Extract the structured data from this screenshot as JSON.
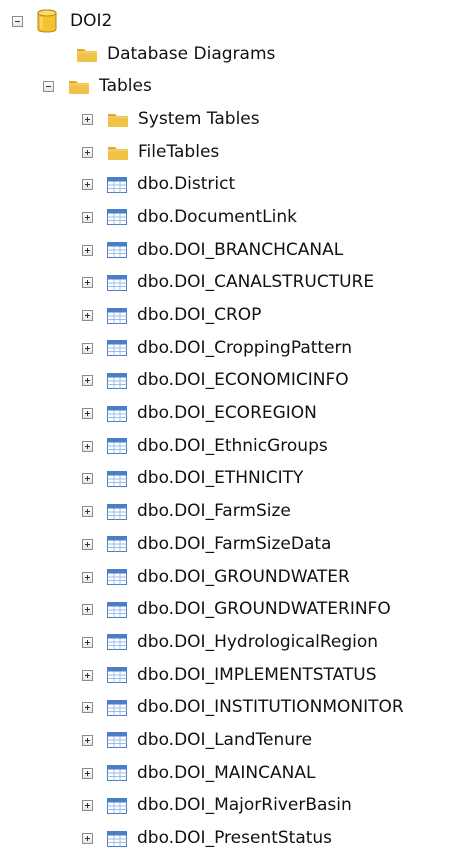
{
  "database": {
    "name": "DOI2",
    "expanded": true,
    "icon": "database-icon"
  },
  "folders": {
    "diagrams_label": "Database Diagrams",
    "tables_label": "Tables",
    "tables_expanded": true
  },
  "subfolders": [
    {
      "label": "System Tables"
    },
    {
      "label": "FileTables"
    }
  ],
  "tables": [
    "dbo.District",
    "dbo.DocumentLink",
    "dbo.DOI_BRANCHCANAL",
    "dbo.DOI_CANALSTRUCTURE",
    "dbo.DOI_CROP",
    "dbo.DOI_CroppingPattern",
    "dbo.DOI_ECONOMICINFO",
    "dbo.DOI_ECOREGION",
    "dbo.DOI_EthnicGroups",
    "dbo.DOI_ETHNICITY",
    "dbo.DOI_FarmSize",
    "dbo.DOI_FarmSizeData",
    "dbo.DOI_GROUNDWATER",
    "dbo.DOI_GROUNDWATERINFO",
    "dbo.DOI_HydrologicalRegion",
    "dbo.DOI_IMPLEMENTSTATUS",
    "dbo.DOI_INSTITUTIONMONITOR",
    "dbo.DOI_LandTenure",
    "dbo.DOI_MAINCANAL",
    "dbo.DOI_MajorRiverBasin",
    "dbo.DOI_PresentStatus"
  ],
  "colors": {
    "folder_body": "#f0c247",
    "folder_tab": "#e0a82e",
    "db_body": "#f2c230",
    "db_top": "#f8dc70",
    "table_header": "#4a7fc8",
    "table_grid": "#9dbde6"
  }
}
